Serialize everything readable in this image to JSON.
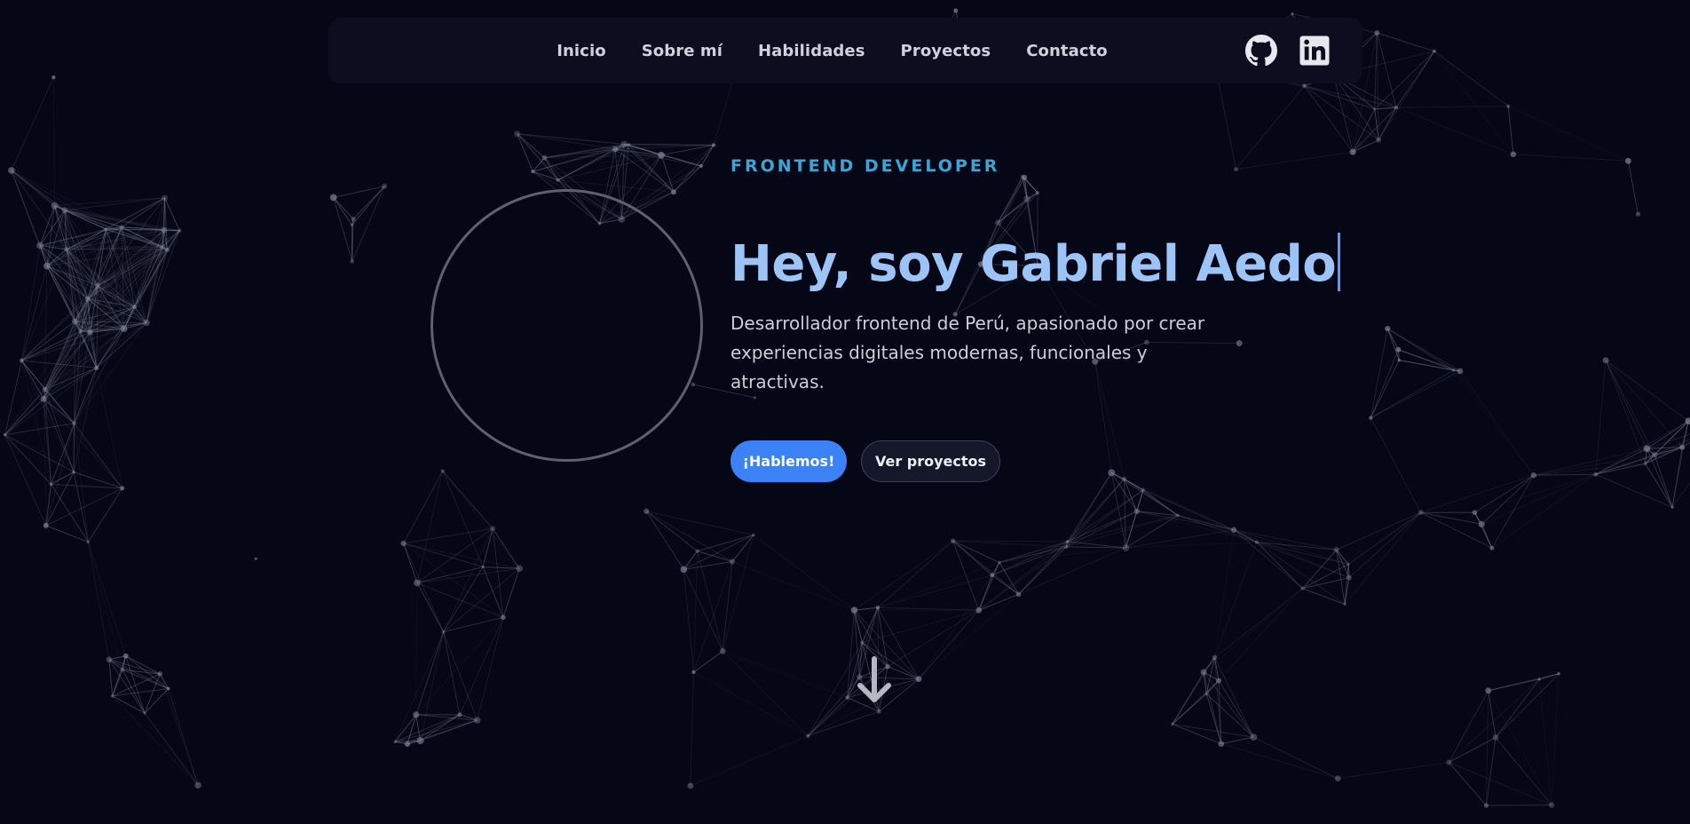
{
  "nav": {
    "items": [
      {
        "label": "Inicio"
      },
      {
        "label": "Sobre mí"
      },
      {
        "label": "Habilidades"
      },
      {
        "label": "Proyectos"
      },
      {
        "label": "Contacto"
      }
    ],
    "socials": [
      {
        "icon": "github-icon"
      },
      {
        "icon": "linkedin-icon"
      }
    ]
  },
  "hero": {
    "eyebrow": "FRONTEND DEVELOPER",
    "headline": "Hey, soy Gabriel Aedo",
    "description": "Desarrollador frontend de Perú, apasionado por crear experiencias digitales modernas, funcionales y atractivas.",
    "primary_button": "¡Hablemos!",
    "secondary_button": "Ver proyectos",
    "scroll_icon": "arrow-down-icon"
  },
  "colors": {
    "background": "#050716",
    "navbar": "#0c0e20",
    "accent": "#3b82f6",
    "eyebrow": "#3aa6d6",
    "headline": "#9cc4f6"
  }
}
